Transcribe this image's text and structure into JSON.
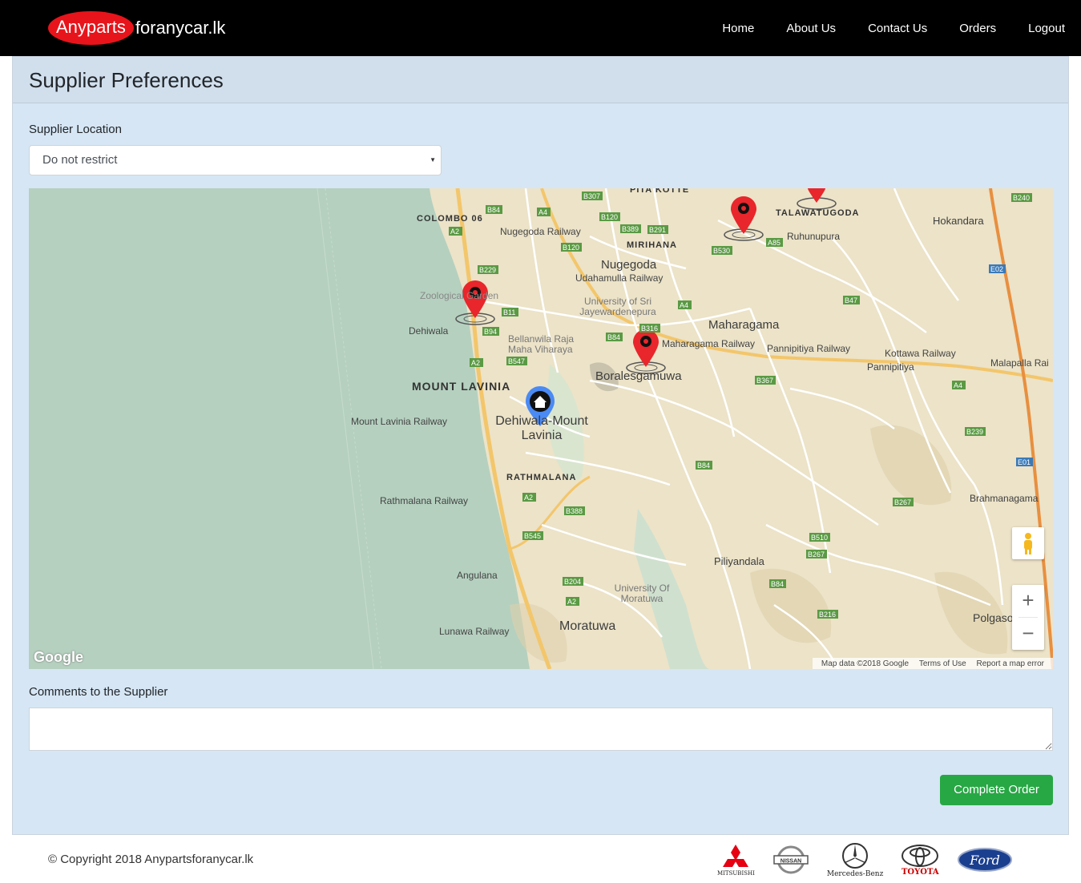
{
  "navbar": {
    "brand_highlight": "Anyparts",
    "brand_rest": "foranycar.lk",
    "links": [
      "Home",
      "About Us",
      "Contact Us",
      "Orders",
      "Logout"
    ]
  },
  "card": {
    "title": "Supplier Preferences",
    "location_label": "Supplier Location",
    "location_value": "Do not restrict",
    "comments_label": "Comments to the Supplier",
    "submit_label": "Complete Order"
  },
  "map": {
    "labels_big": [
      "COLOMBO 06",
      "MOUNT LAVINIA",
      "RATHMALANA",
      "TALAWATUGODA",
      "MIRIHANA",
      "PITA KOTTE"
    ],
    "towns": [
      "Nugegoda",
      "Maharagama",
      "Boralesgamuwa",
      "Dehiwala-Mount Lavinia",
      "Moratuwa",
      "Piliyandala",
      "Hokandara",
      "Ruhunupura",
      "Pannipitiya",
      "Brahmanagama",
      "Polgasowita"
    ],
    "places": [
      "Nugegoda Railway",
      "Udahamulla Railway",
      "University of Sri Jayewardenepura",
      "Zoological Garden",
      "Dehiwala",
      "Bellanwila Raja Maha Viharaya",
      "Maharagama Railway",
      "Pannipitiya Railway",
      "Kottawa Railway",
      "Malapalla Rai",
      "Mount Lavinia Railway",
      "Rathmalana Railway",
      "Angulana",
      "Lunawa Railway",
      "University Of Moratuwa"
    ],
    "google": "Google",
    "attribution": [
      "Map data ©2018 Google",
      "Terms of Use",
      "Report a map error"
    ],
    "zoom_in": "+",
    "zoom_out": "−",
    "markers": {
      "supplier_count": 4,
      "home_count": 1
    },
    "colors": {
      "water": "#b5d0bf",
      "land": "#ece3c8",
      "supplier_pin": "#e8262b",
      "home_pin": "#4a8af4"
    }
  },
  "footer": {
    "copyright": "© Copyright 2018 Anypartsforanycar.lk",
    "brands": [
      "MITSUBISHI",
      "NISSAN",
      "Mercedes-Benz",
      "TOYOTA",
      "Ford"
    ]
  }
}
